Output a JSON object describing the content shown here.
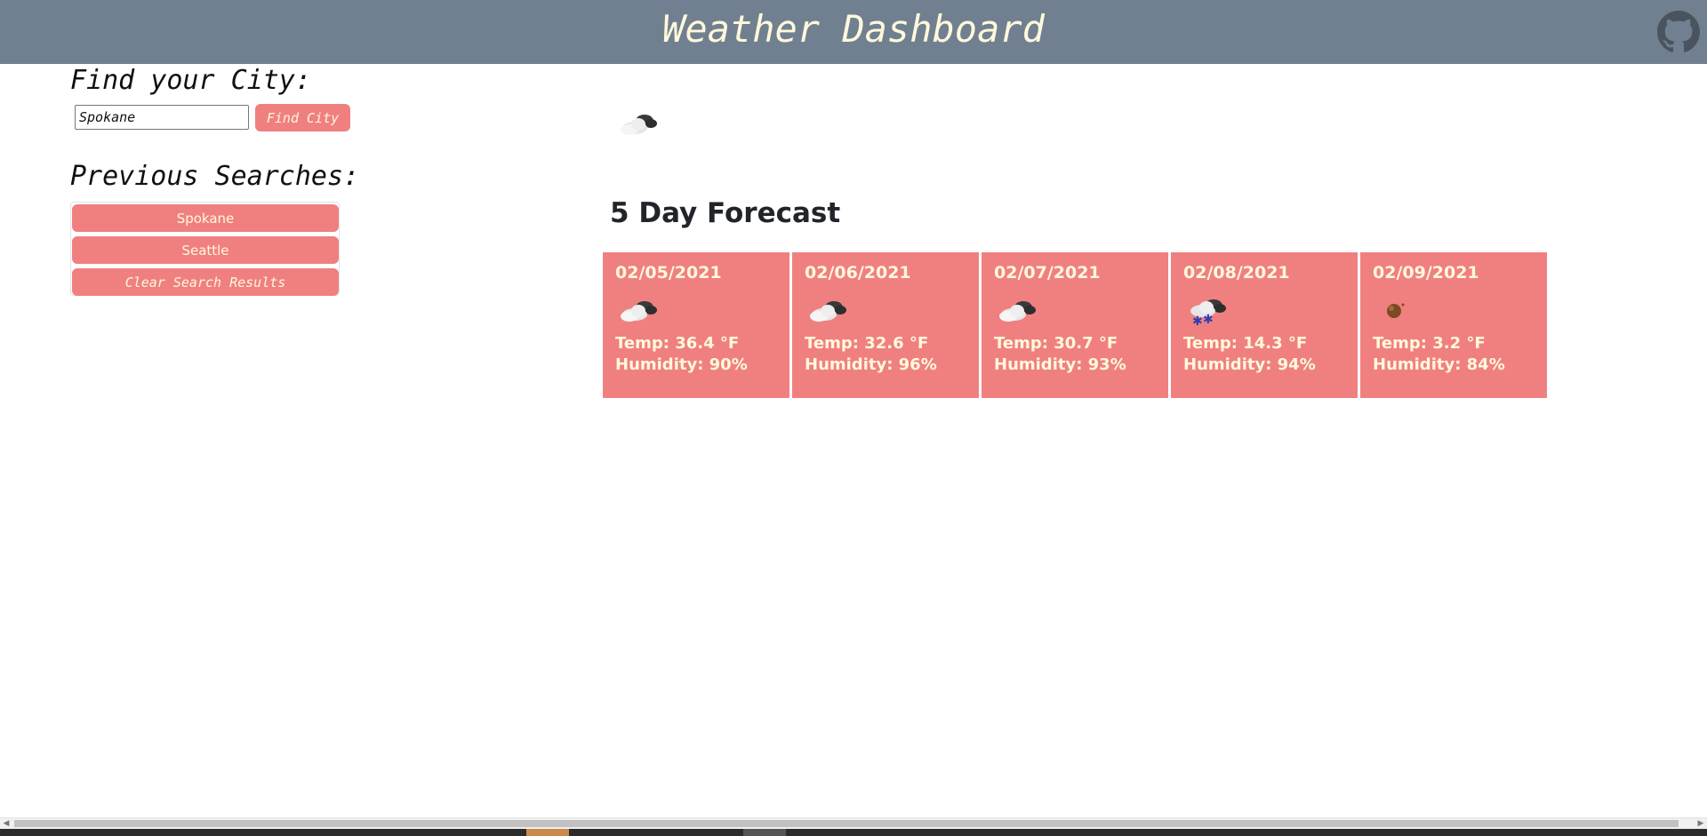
{
  "header": {
    "title": "Weather Dashboard",
    "github_icon": "github-icon"
  },
  "search": {
    "heading": "Find your City:",
    "value": "Spokane",
    "button_label": "Find City"
  },
  "history": {
    "heading": "Previous Searches:",
    "items": [
      "Spokane",
      "Seattle"
    ],
    "clear_label": "Clear Search Results"
  },
  "current": {
    "icon": "few-clouds-icon"
  },
  "forecast": {
    "heading": "5 Day Forecast",
    "days": [
      {
        "date": "02/05/2021",
        "icon": "few-clouds-icon",
        "temp": "Temp: 36.4 °F",
        "humidity": "Humidity: 90%"
      },
      {
        "date": "02/06/2021",
        "icon": "few-clouds-icon",
        "temp": "Temp: 32.6 °F",
        "humidity": "Humidity: 96%"
      },
      {
        "date": "02/07/2021",
        "icon": "few-clouds-icon",
        "temp": "Temp: 30.7 °F",
        "humidity": "Humidity: 93%"
      },
      {
        "date": "02/08/2021",
        "icon": "snow-icon",
        "temp": "Temp: 14.3 °F",
        "humidity": "Humidity: 94%"
      },
      {
        "date": "02/09/2021",
        "icon": "clear-night-icon",
        "temp": "Temp: 3.2 °F",
        "humidity": "Humidity: 84%"
      }
    ]
  },
  "colors": {
    "header_bg": "#708090",
    "header_text": "#fff8dc",
    "accent": "#f08080",
    "accent_text": "#fff8dc"
  }
}
